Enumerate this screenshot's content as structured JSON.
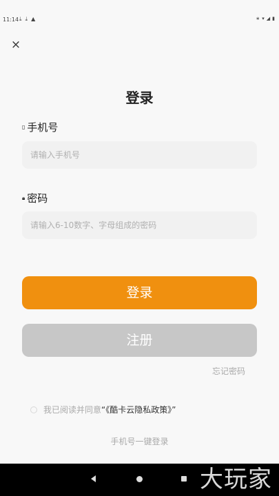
{
  "status_bar": {
    "time": "11:14",
    "left_icons": [
      "download-icon",
      "download-icon",
      "warning-icon"
    ],
    "right_icons": [
      "bluetooth-icon",
      "wifi-icon",
      "signal-icon",
      "battery-icon"
    ]
  },
  "header": {
    "close_icon": "close-icon",
    "title": "登录"
  },
  "form": {
    "phone_label": "手机号",
    "phone_placeholder": "请输入手机号",
    "phone_value": "",
    "password_label": "密码",
    "password_placeholder": "请输入6-10数字、字母组成的密码",
    "password_value": ""
  },
  "buttons": {
    "login": "登录",
    "register": "注册",
    "forgot_password": "忘记密码"
  },
  "agreement": {
    "prefix": "我已阅读并同意",
    "policy": "“《酷卡云隐私政策》”",
    "checked": false
  },
  "alt_login": "手机号一键登录",
  "nav": {
    "back_icon": "back-icon",
    "home_icon": "home-icon",
    "recent_icon": "recents-icon"
  },
  "watermark": "大玩家",
  "colors": {
    "primary": "#f0900f",
    "disabled": "#c7c7c7",
    "background": "#f8f8f8"
  }
}
